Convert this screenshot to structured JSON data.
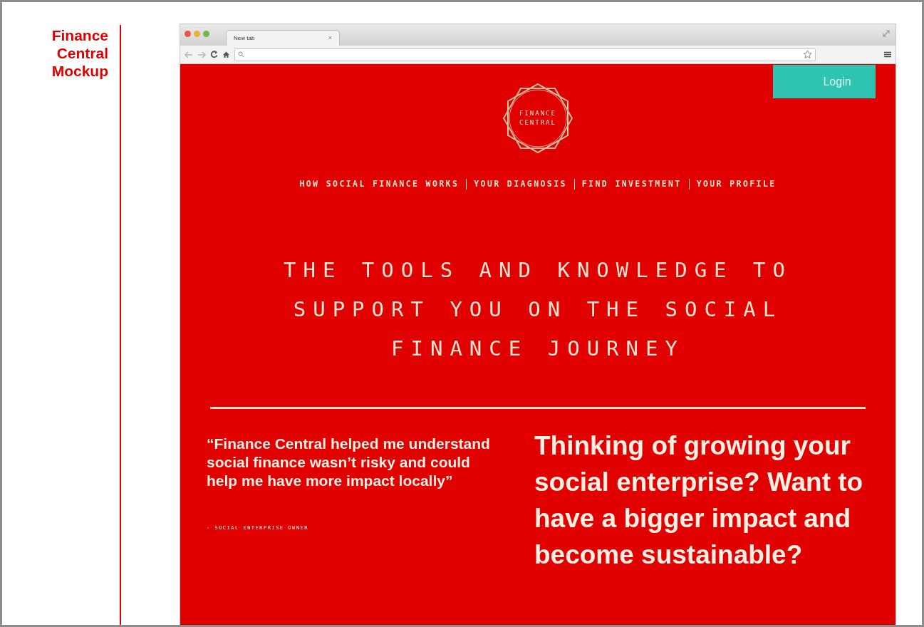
{
  "slide_title": [
    "Finance",
    "Central",
    "Mockup"
  ],
  "browser": {
    "tab": {
      "title": "New tab",
      "close": "×"
    }
  },
  "page": {
    "login_button": "Login",
    "logo": [
      "FINANCE",
      "CENTRAL"
    ],
    "nav": [
      {
        "label": "HOW SOCIAL FINANCE WORKS"
      },
      {
        "label": "YOUR DIAGNOSIS"
      },
      {
        "label": "FIND INVESTMENT"
      },
      {
        "label": "YOUR PROFILE"
      }
    ],
    "headline": [
      "THE TOOLS AND KNOWLEDGE TO",
      "SUPPORT YOU ON THE SOCIAL",
      "FINANCE JOURNEY"
    ],
    "quote": "“Finance Central helped me understand social finance wasn’t risky and could help me have more impact locally”",
    "quote_source": "- SOCIAL ENTERPRISE OWNER",
    "pitch": "Thinking of growing your social enterprise? Want to have a bigger impact and become sustainable?"
  }
}
